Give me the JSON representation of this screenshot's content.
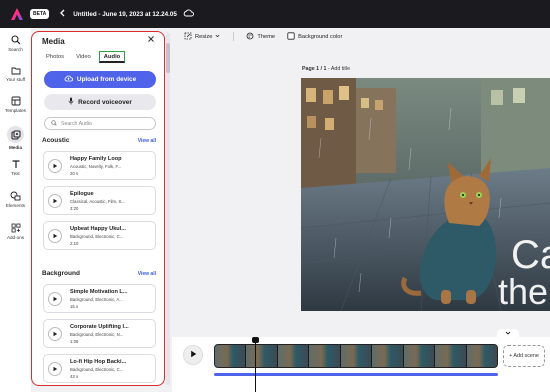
{
  "header": {
    "beta_badge": "BETA",
    "document_title": "Untitled - June 19, 2023 at 12.24.05"
  },
  "rail": {
    "items": [
      {
        "label": "Search",
        "icon": "search-icon"
      },
      {
        "label": "Your stuff",
        "icon": "folder-icon"
      },
      {
        "label": "Templates",
        "icon": "templates-icon"
      },
      {
        "label": "Media",
        "icon": "media-icon"
      },
      {
        "label": "Text",
        "icon": "text-icon"
      },
      {
        "label": "Elements",
        "icon": "elements-icon"
      },
      {
        "label": "Add-ons",
        "icon": "add-ons-icon"
      }
    ],
    "active": "Media"
  },
  "media_panel": {
    "title": "Media",
    "tabs": [
      "Photos",
      "Video",
      "Audio"
    ],
    "active_tab": "Audio",
    "upload_label": "Upload from device",
    "record_label": "Record voiceover",
    "search_placeholder": "Search Audio",
    "sections": [
      {
        "title": "Acoustic",
        "view_all": "View all",
        "tracks": [
          {
            "title": "Happy Family Loop",
            "tags": "Acoustic, Novelty, Folk, F...",
            "duration": "20 s"
          },
          {
            "title": "Epilogue",
            "tags": "Classical, Acoustic, Film, S...",
            "duration": "3:20"
          },
          {
            "title": "Upbeat Happy Ukul...",
            "tags": "Background, Electronic, C...",
            "duration": "2:10"
          }
        ]
      },
      {
        "title": "Background",
        "view_all": "View all",
        "tracks": [
          {
            "title": "Simple Motivation L...",
            "tags": "Background, Electronic, A...",
            "duration": "15 s"
          },
          {
            "title": "Corporate Uplifting I...",
            "tags": "Background, Electronic, N...",
            "duration": "1:05"
          },
          {
            "title": "Lo-fi Hip Hop Backi...",
            "tags": "Background, Electronic, C...",
            "duration": "43 s"
          }
        ]
      }
    ]
  },
  "toolbar": {
    "resize": "Resize",
    "theme": "Theme",
    "background_color": "Background color"
  },
  "canvas": {
    "page_indicator": "Page 1 / 1",
    "add_title": "Add title",
    "overlay_text_line1": "Ca",
    "overlay_text_line2": "the"
  },
  "timeline": {
    "add_scene": "+ Add scene"
  },
  "colors": {
    "accent": "#4f62ea",
    "panel_highlight": "#d92c2c",
    "tab_highlight": "#2e9e4a",
    "topbar": "#1b1b1f"
  }
}
